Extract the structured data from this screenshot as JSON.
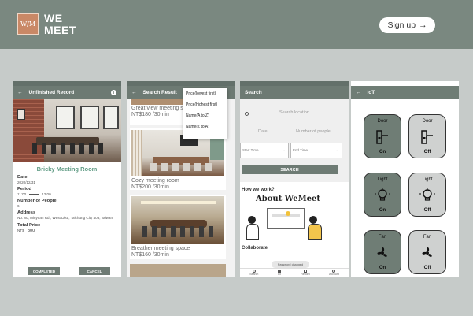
{
  "header": {
    "logo_mark": "W/M",
    "logo_line1": "WE",
    "logo_line2": "MEET",
    "signup_label": "Sign up",
    "signup_arrow": "→"
  },
  "screen1": {
    "title": "Unfinished Record",
    "back": "←",
    "info": "i",
    "room_name": "Bricky Meeting Room",
    "date_label": "Date",
    "date_value": "2020/12/31",
    "period_label": "Period",
    "period_start": "11:00",
    "period_end": "12:00",
    "people_label": "Number of People",
    "people_value": "6",
    "address_label": "Address",
    "address_value": "No. 80, Minyuan Rd., West Dist., Taichung City 403, Taiwan",
    "price_label": "Total Price",
    "price_currency": "NT$",
    "price_value": "300",
    "completed_label": "COMPLETED",
    "cancel_label": "CANCEL"
  },
  "screen2": {
    "title": "Search Result",
    "back": "←",
    "menu": [
      "Price(lowest first)",
      "Price(highest first)",
      "Name(A to Z)",
      "Name(Z to A)"
    ],
    "cards": [
      {
        "title": "Great view meeting sp",
        "price": "NT$180   /30min"
      },
      {
        "title": "Cozy meeting room",
        "price": "NT$200   /30min"
      },
      {
        "title": "Breather meeting space",
        "price": "NT$160   /30min"
      }
    ]
  },
  "screen3": {
    "title": "Search",
    "search_placeholder": "Search location",
    "date_placeholder": "Date",
    "people_placeholder": "Number of people",
    "start_time": "Start Time",
    "end_time": "End Time",
    "search_btn": "SEARCH",
    "how_title": "How we work?",
    "about_title": "About  WeMeet",
    "collab_title": "Collaborate",
    "toast": "Password changed",
    "nav": [
      "Search",
      "IoT",
      "Record",
      "Account"
    ]
  },
  "screen4": {
    "title": "IoT",
    "back": "←",
    "devices": [
      {
        "name": "Door",
        "state": "On"
      },
      {
        "name": "Door",
        "state": "Off"
      },
      {
        "name": "Light",
        "state": "On"
      },
      {
        "name": "Light",
        "state": "Off"
      },
      {
        "name": "Fan",
        "state": "On"
      },
      {
        "name": "Fan",
        "state": "Off"
      }
    ]
  },
  "colors": {
    "header_bg": "#7a8880",
    "page_bg": "#c6cbc9",
    "accent": "#5f9b84",
    "app_bar": "#6d7a73"
  }
}
